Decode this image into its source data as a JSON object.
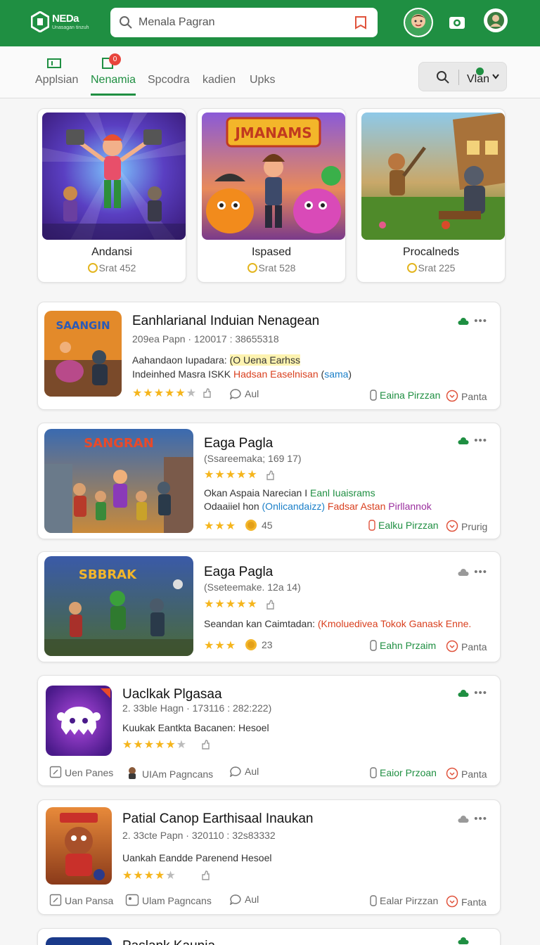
{
  "header": {
    "brand": "NEDa",
    "tagline": "Unasagan tinzuh",
    "search_placeholder": "Menala Pagran"
  },
  "tabs": [
    {
      "label": "Applsian"
    },
    {
      "label": "Nenamia",
      "badge": "0"
    },
    {
      "label": "Spcodra"
    },
    {
      "label": "kadien"
    },
    {
      "label": "Upks"
    }
  ],
  "filter": {
    "label": "Vlan"
  },
  "featured": [
    {
      "name": "Andansi",
      "stat": "Srat 452"
    },
    {
      "name": "Ispased",
      "stat": "Srat 528",
      "banner": "JMANAMS"
    },
    {
      "name": "Procalneds",
      "stat": "Srat 225"
    }
  ],
  "cards": [
    {
      "title": "Eanhlarianal Induian Nenagean",
      "meta": "209ea Papn · 120017 : 38655318",
      "line1": [
        "Aahandaon Iupadara: ",
        "(O Uena Earhss"
      ],
      "line2": [
        "Indeinhed Masra ISKK ",
        "Hadsan Easelnisan",
        " (",
        "sama",
        ")"
      ],
      "comment": "Aul",
      "action_primary": "Eaina Pirzzan",
      "action_secondary": "Panta",
      "thumb_text": "SAANGIN"
    },
    {
      "title": "Eaga Pagla",
      "meta": "(Ssareemaka; 169 17)",
      "line1": [
        "Okan Aspaia Narecian I ",
        "Eanl Iuaisrams"
      ],
      "line2": [
        "Odaaiiel hon ",
        "(Onlicandaizz)",
        " Fadsar Astan ",
        "Pirllannok"
      ],
      "rating_count": "45",
      "action_primary": "Ealku Pirzzan",
      "action_secondary": "Prurig",
      "thumb_text": "SANGRAN"
    },
    {
      "title": "Eaga Pagla",
      "meta": "(Sseteemake. 12a 14)",
      "line1": [
        "Seandan kan Caimtadan: ",
        "(Kmoluedivea Tokok Ganask Enne."
      ],
      "rating_count": "23",
      "action_primary": "Eahn Przaim",
      "action_secondary": "Panta",
      "thumb_text": "SBBRAK"
    },
    {
      "title": "Uaclkak Plgasaa",
      "meta": "2. 33ble Hagn · 173116 : 282:222)",
      "line1": [
        "Kuukak Eantkta Bacanen: Hesoel"
      ],
      "tool1": "Uen Panes",
      "tool2": "UIAm Pagncans",
      "comment": "Aul",
      "action_primary": "Eaior Przoan",
      "action_secondary": "Panta"
    },
    {
      "title": "Patial Canop Earthisaal Inaukan",
      "meta": "2. 33cte Papn · 320110 : 32s83332",
      "line1": [
        "Uankah Eandde Parenend Hesoel"
      ],
      "tool1": "Uan Pansa",
      "tool2": "Ulam Pagncans",
      "comment": "Aul",
      "action_primary": "Ealar Pirzzan",
      "action_secondary": "Fanta"
    },
    {
      "title": "Paslank Kaunia"
    }
  ],
  "colors": {
    "brand_green": "#1f8f42",
    "star": "#f5b51c",
    "badge_red": "#e8453c"
  }
}
